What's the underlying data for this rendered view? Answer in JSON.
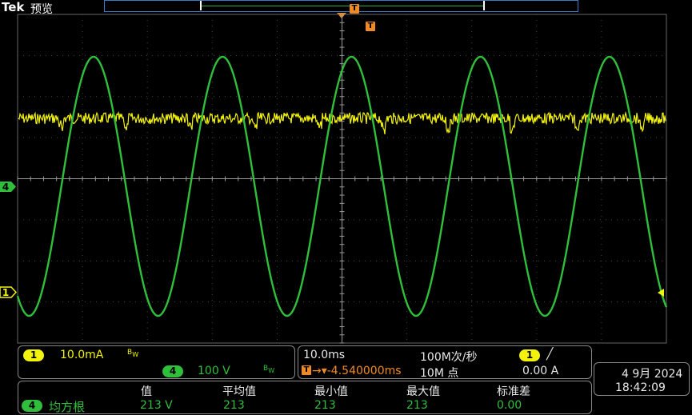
{
  "header": {
    "brand": "Tek",
    "mode": "预览",
    "trigger_badge": "T"
  },
  "markers": {
    "ch4": "4",
    "ch1": "1"
  },
  "channel_panel": {
    "ch1": {
      "number": "1",
      "scale": "10.0mA",
      "bw": "B",
      "bw_sub": "W"
    },
    "ch4": {
      "number": "4",
      "scale": "100 V",
      "bw": "B",
      "bw_sub": "W"
    }
  },
  "timebase_panel": {
    "horizontal_scale": "10.0ms",
    "sample_rate": "100M次/秒",
    "trigger_channel": "1",
    "trigger_slope": "╱",
    "trigger_position_badge": "T",
    "trigger_position": "→▾-4.540000ms",
    "record_length": "10M 点",
    "trigger_level": "0.00 A"
  },
  "datetime": {
    "date": "4 9月 2024",
    "time": "18:42:09"
  },
  "measurement": {
    "headers": [
      "值",
      "平均值",
      "最小值",
      "最大值",
      "标准差"
    ],
    "channel": "4",
    "name": "均方根",
    "values": [
      "213 V",
      "213",
      "213",
      "213",
      "0.00"
    ]
  },
  "colors": {
    "ch1": "#f2f20c",
    "ch4": "#2fbf3a",
    "trigger": "#f08a24",
    "overview_border": "#3a78c8"
  },
  "waveforms": {
    "ch4_sine": {
      "cycles_on_screen": 5,
      "color": "#2fbf3a"
    },
    "ch1_noise": {
      "color": "#f2f20c"
    }
  }
}
